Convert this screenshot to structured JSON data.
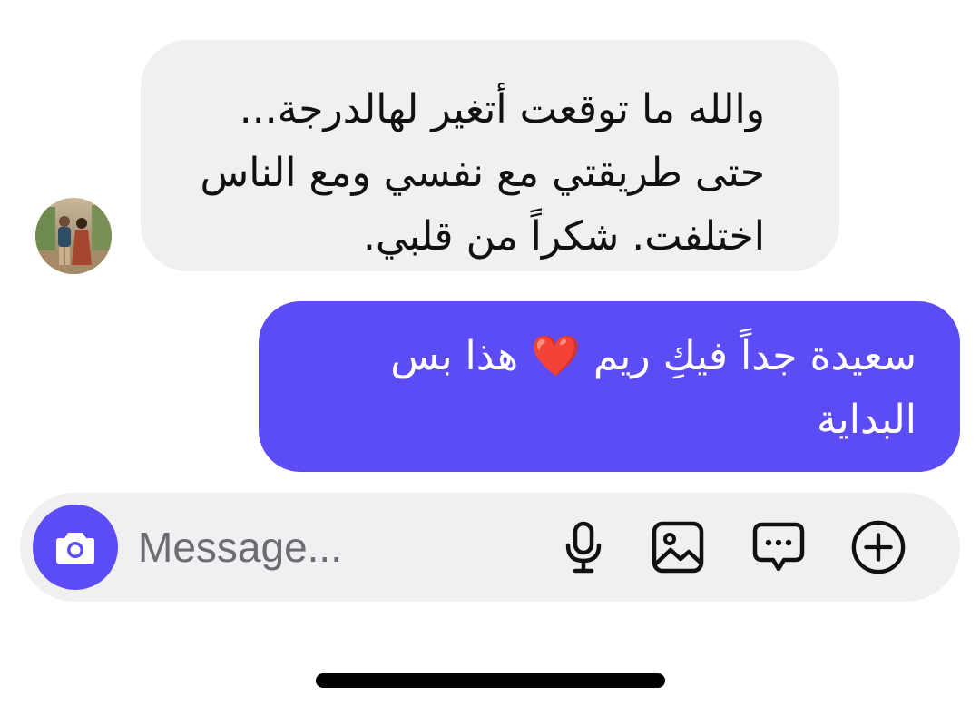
{
  "conversation": {
    "incoming": {
      "lines": [
        "والله ما توقعت أتغير لهالدرجة...",
        "حتى طريقتي مع نفسي ومع الناس",
        "اختلفت. شكراً من قلبي."
      ]
    },
    "outgoing": {
      "lines": [
        "سعيدة جداً فيكِ ريم ❤️ هذا بس",
        "البداية"
      ]
    }
  },
  "composer": {
    "placeholder": "Message...",
    "camera_icon": "camera-icon",
    "tools": [
      "microphone-icon",
      "image-icon",
      "chat-bubble-icon",
      "add-icon"
    ]
  },
  "colors": {
    "accent": "#5b4cf5",
    "incoming_bubble": "#f0f0f2",
    "composer_bg": "#f0f0f2"
  }
}
